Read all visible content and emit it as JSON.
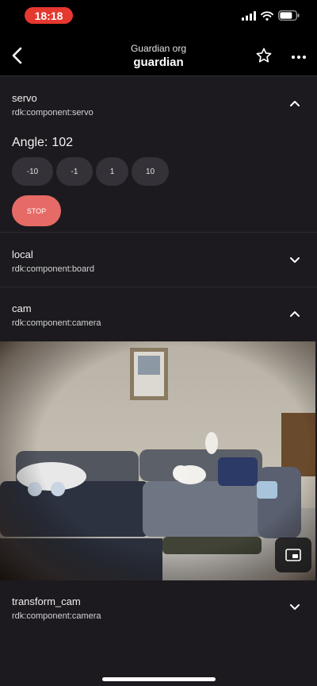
{
  "status": {
    "time": "18:18"
  },
  "nav": {
    "org": "Guardian org",
    "robot": "guardian"
  },
  "sections": {
    "servo": {
      "name": "servo",
      "type": "rdk:component:servo",
      "angle_label": "Angle:",
      "angle_value": "102",
      "steps": [
        "-10",
        "-1",
        "1",
        "10"
      ],
      "stop_label": "STOP"
    },
    "local": {
      "name": "local",
      "type": "rdk:component:board"
    },
    "cam": {
      "name": "cam",
      "type": "rdk:component:camera"
    },
    "transform_cam": {
      "name": "transform_cam",
      "type": "rdk:component:camera"
    }
  },
  "colors": {
    "stop": "#e66a65",
    "time_pill": "#e5382f",
    "background": "#1c1a1f"
  }
}
